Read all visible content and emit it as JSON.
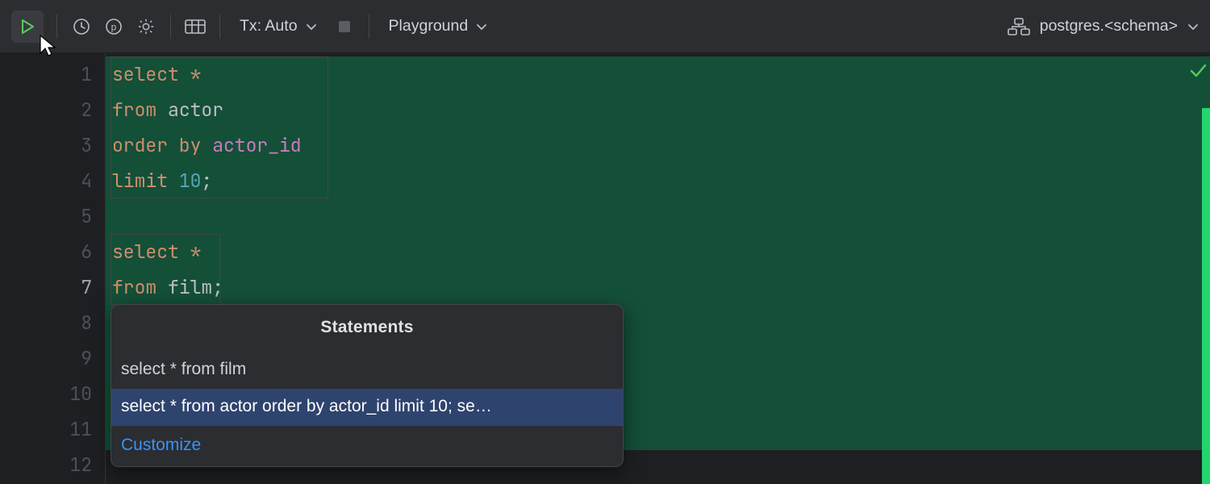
{
  "toolbar": {
    "tx_label": "Tx: Auto",
    "playground_label": "Playground"
  },
  "datasource": {
    "label": "postgres.<schema>"
  },
  "editor": {
    "line_numbers": [
      "1",
      "2",
      "3",
      "4",
      "5",
      "6",
      "7",
      "8",
      "9",
      "10",
      "11",
      "12"
    ],
    "current_line": 7,
    "lines": [
      [
        {
          "t": "select ",
          "c": "kw"
        },
        {
          "t": "*",
          "c": "star"
        }
      ],
      [
        {
          "t": "from ",
          "c": "kw"
        },
        {
          "t": "actor",
          "c": "txt"
        }
      ],
      [
        {
          "t": "order by ",
          "c": "kw"
        },
        {
          "t": "actor_id",
          "c": "id"
        }
      ],
      [
        {
          "t": "limit ",
          "c": "kw"
        },
        {
          "t": "10",
          "c": "str"
        },
        {
          "t": ";",
          "c": "txt"
        }
      ],
      [],
      [
        {
          "t": "select ",
          "c": "kw"
        },
        {
          "t": "*",
          "c": "star"
        }
      ],
      [
        {
          "t": "from ",
          "c": "kw"
        },
        {
          "t": "film",
          "c": "txt"
        },
        {
          "t": ";",
          "c": "txt"
        }
      ],
      [],
      [],
      [],
      [],
      []
    ]
  },
  "popup": {
    "title": "Statements",
    "items": [
      "select * from film",
      "select * from actor order by actor_id limit 10; se…"
    ],
    "selected_index": 1,
    "footer_link": "Customize"
  }
}
